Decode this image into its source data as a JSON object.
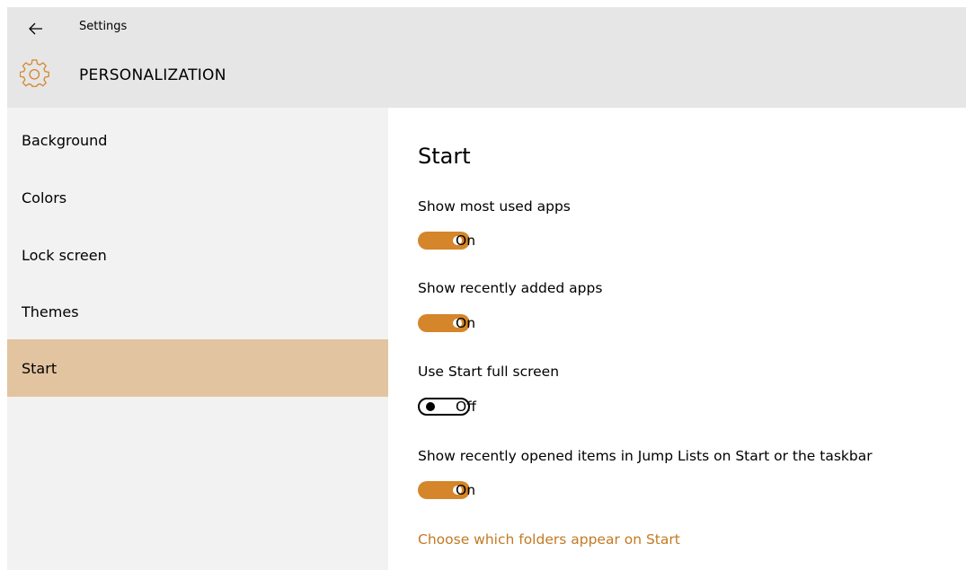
{
  "window": {
    "title": "Settings"
  },
  "header": {
    "section_title": "PERSONALIZATION",
    "section_icon": "gear-icon",
    "back_icon": "back-arrow-icon"
  },
  "sidebar": {
    "items": [
      {
        "label": "Background",
        "active": false
      },
      {
        "label": "Colors",
        "active": false
      },
      {
        "label": "Lock screen",
        "active": false
      },
      {
        "label": "Themes",
        "active": false
      },
      {
        "label": "Start",
        "active": true
      }
    ]
  },
  "main": {
    "heading": "Start",
    "settings": [
      {
        "label": "Show most used apps",
        "state": "On",
        "on": true
      },
      {
        "label": "Show recently added apps",
        "state": "On",
        "on": true
      },
      {
        "label": "Use Start full screen",
        "state": "Off",
        "on": false
      },
      {
        "label": "Show recently opened items in Jump Lists on Start or the taskbar",
        "state": "On",
        "on": true
      }
    ],
    "link": "Choose which folders appear on Start"
  },
  "colors": {
    "accent": "#d5852a",
    "selected_nav": "#e3c4a0",
    "link": "#c27a23"
  }
}
